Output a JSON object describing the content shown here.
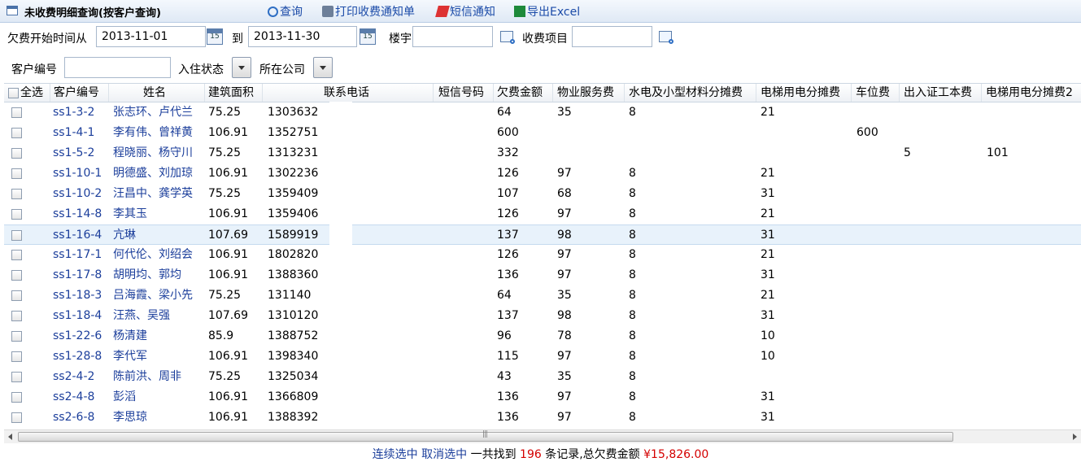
{
  "title": "未收费明细查询(按客户查询)",
  "toolbar": {
    "query": "查询",
    "print": "打印收费通知单",
    "sms": "短信通知",
    "excel": "导出Excel"
  },
  "filters": {
    "arrears_from_label": "欠费开始时间从",
    "start_date": "2013-11-01",
    "to_label": "到",
    "end_date": "2013-11-30",
    "building_label": "楼宇",
    "building_value": "",
    "item_label": "收费项目",
    "item_value": "",
    "customer_no_label": "客户编号",
    "customer_no_value": "",
    "status_label": "入住状态",
    "company_label": "所在公司"
  },
  "columns": [
    "全选",
    "客户编号",
    "姓名",
    "建筑面积",
    "联系电话",
    "短信号码",
    "欠费金额",
    "物业服务费",
    "水电及小型材料分摊费",
    "电梯用电分摊费",
    "车位费",
    "出入证工本费",
    "电梯用电分摊费2"
  ],
  "rows": [
    {
      "id": "ss1-3-2",
      "name": "张志环、卢代兰",
      "area": "75.25",
      "phone": "1303632",
      "sms": "",
      "owed": "64",
      "service": "35",
      "water": "8",
      "elevator": "21",
      "parking": "",
      "pass": "",
      "elevator2": ""
    },
    {
      "id": "ss1-4-1",
      "name": "李有伟、曾祥黄",
      "area": "106.91",
      "phone": "1352751",
      "sms": "",
      "owed": "600",
      "service": "",
      "water": "",
      "elevator": "",
      "parking": "600",
      "pass": "",
      "elevator2": ""
    },
    {
      "id": "ss1-5-2",
      "name": "程晓丽、杨守川",
      "area": "75.25",
      "phone": "1313231",
      "sms": "",
      "owed": "332",
      "service": "",
      "water": "",
      "elevator": "",
      "parking": "",
      "pass": "5",
      "elevator2": "101"
    },
    {
      "id": "ss1-10-1",
      "name": "明德盛、刘加琼",
      "area": "106.91",
      "phone": "1302236",
      "sms": "",
      "owed": "126",
      "service": "97",
      "water": "8",
      "elevator": "21",
      "parking": "",
      "pass": "",
      "elevator2": ""
    },
    {
      "id": "ss1-10-2",
      "name": "汪昌中、龚学英",
      "area": "75.25",
      "phone": "1359409",
      "sms": "",
      "owed": "107",
      "service": "68",
      "water": "8",
      "elevator": "31",
      "parking": "",
      "pass": "",
      "elevator2": ""
    },
    {
      "id": "ss1-14-8",
      "name": "李其玉",
      "area": "106.91",
      "phone": "1359406",
      "sms": "",
      "owed": "126",
      "service": "97",
      "water": "8",
      "elevator": "21",
      "parking": "",
      "pass": "",
      "elevator2": ""
    },
    {
      "id": "ss1-16-4",
      "name": "亢琳",
      "area": "107.69",
      "phone": "1589919",
      "sms": "",
      "owed": "137",
      "service": "98",
      "water": "8",
      "elevator": "31",
      "parking": "",
      "pass": "",
      "elevator2": ""
    },
    {
      "id": "ss1-17-1",
      "name": "何代伦、刘绍会",
      "area": "106.91",
      "phone": "1802820",
      "sms": "",
      "owed": "126",
      "service": "97",
      "water": "8",
      "elevator": "21",
      "parking": "",
      "pass": "",
      "elevator2": ""
    },
    {
      "id": "ss1-17-8",
      "name": "胡明均、郭均",
      "area": "106.91",
      "phone": "1388360",
      "sms": "",
      "owed": "136",
      "service": "97",
      "water": "8",
      "elevator": "31",
      "parking": "",
      "pass": "",
      "elevator2": ""
    },
    {
      "id": "ss1-18-3",
      "name": "吕海霞、梁小先",
      "area": "75.25",
      "phone": "131140",
      "sms": "",
      "owed": "64",
      "service": "35",
      "water": "8",
      "elevator": "21",
      "parking": "",
      "pass": "",
      "elevator2": ""
    },
    {
      "id": "ss1-18-4",
      "name": "汪燕、吴强",
      "area": "107.69",
      "phone": "1310120",
      "sms": "",
      "owed": "137",
      "service": "98",
      "water": "8",
      "elevator": "31",
      "parking": "",
      "pass": "",
      "elevator2": ""
    },
    {
      "id": "ss1-22-6",
      "name": "杨清建",
      "area": "85.9",
      "phone": "1388752",
      "sms": "",
      "owed": "96",
      "service": "78",
      "water": "8",
      "elevator": "10",
      "parking": "",
      "pass": "",
      "elevator2": ""
    },
    {
      "id": "ss1-28-8",
      "name": "李代军",
      "area": "106.91",
      "phone": "1398340",
      "sms": "",
      "owed": "115",
      "service": "97",
      "water": "8",
      "elevator": "10",
      "parking": "",
      "pass": "",
      "elevator2": ""
    },
    {
      "id": "ss2-4-2",
      "name": "陈前洪、周非",
      "area": "75.25",
      "phone": "1325034",
      "sms": "",
      "owed": "43",
      "service": "35",
      "water": "8",
      "elevator": "",
      "parking": "",
      "pass": "",
      "elevator2": ""
    },
    {
      "id": "ss2-4-8",
      "name": "彭滔",
      "area": "106.91",
      "phone": "1366809",
      "sms": "",
      "owed": "136",
      "service": "97",
      "water": "8",
      "elevator": "31",
      "parking": "",
      "pass": "",
      "elevator2": ""
    },
    {
      "id": "ss2-6-8",
      "name": "李思琼",
      "area": "106.91",
      "phone": "1388392",
      "sms": "",
      "owed": "136",
      "service": "97",
      "water": "8",
      "elevator": "31",
      "parking": "",
      "pass": "",
      "elevator2": ""
    }
  ],
  "footer": {
    "select_continuous": "连续选中",
    "deselect": "取消选中",
    "found_prefix": "一共找到",
    "count": "196",
    "summary": "条记录,总欠费金额",
    "total": "¥15,826.00"
  },
  "colors": {
    "link": "#1b3e9b",
    "highlight_row": "#e8f2fb",
    "total_red": "#d40000"
  }
}
